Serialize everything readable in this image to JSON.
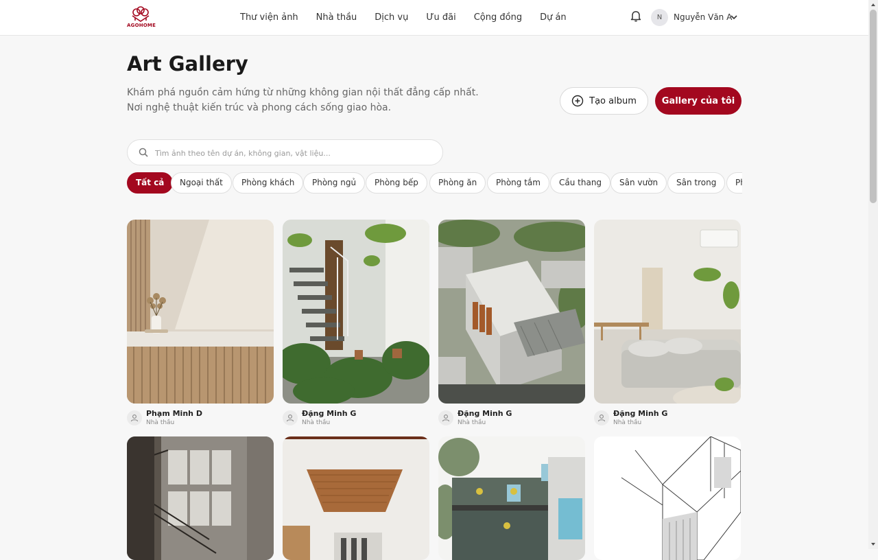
{
  "brand": {
    "name": "AGOHOME",
    "accent": "#a3081f"
  },
  "nav": {
    "items": [
      {
        "label": "Thư viện ảnh"
      },
      {
        "label": "Nhà thầu"
      },
      {
        "label": "Dịch vụ"
      },
      {
        "label": "Ưu đãi"
      },
      {
        "label": "Cộng đồng"
      },
      {
        "label": "Dự án"
      }
    ]
  },
  "user": {
    "initial": "N",
    "name": "Nguyễn Văn A"
  },
  "hero": {
    "title": "Art Gallery",
    "subtitle": "Khám phá nguồn cảm hứng từ những không gian nội thất đẳng cấp nhất. Nơi nghệ thuật kiến trúc và phong cách sống giao hòa.",
    "create_album_label": "Tạo album",
    "my_gallery_label": "Gallery của tôi"
  },
  "search": {
    "placeholder": "Tìm ảnh theo tên dự án, không gian, vật liệu...",
    "value": ""
  },
  "filters": {
    "active": "Tất cả",
    "items": [
      {
        "label": "Tất cả"
      },
      {
        "label": "Ngoại thất"
      },
      {
        "label": "Phòng khách"
      },
      {
        "label": "Phòng ngủ"
      },
      {
        "label": "Phòng bếp"
      },
      {
        "label": "Phòng ăn"
      },
      {
        "label": "Phòng tắm"
      },
      {
        "label": "Cầu thang"
      },
      {
        "label": "Sân vườn"
      },
      {
        "label": "Sân trong"
      },
      {
        "label": "Ph"
      }
    ]
  },
  "gallery": {
    "cards": [
      {
        "image": "minimal-interior-vase-on-counter",
        "author": "Phạm Minh D",
        "role": "Nhà thầu"
      },
      {
        "image": "indoor-garden-floating-staircase",
        "author": "Đặng Minh G",
        "role": "Nhà thầu"
      },
      {
        "image": "aerial-white-house-rooftop",
        "author": "Đặng Minh G",
        "role": "Nhà thầu"
      },
      {
        "image": "bright-living-room-white-sofa",
        "author": "Đặng Minh G",
        "role": "Nhà thầu"
      },
      {
        "image": "double-height-hall-staircase",
        "author": "",
        "role": ""
      },
      {
        "image": "wood-ceiling-corridor",
        "author": "",
        "role": ""
      },
      {
        "image": "section-rendering-house",
        "author": "",
        "role": ""
      },
      {
        "image": "axonometric-line-drawing",
        "author": "",
        "role": ""
      }
    ]
  },
  "icons": {
    "logo": "agohome-logo-icon",
    "bell": "bell-icon",
    "chevron": "chevron-down-icon",
    "plus": "plus-circle-icon",
    "search": "search-icon",
    "user": "user-icon"
  }
}
